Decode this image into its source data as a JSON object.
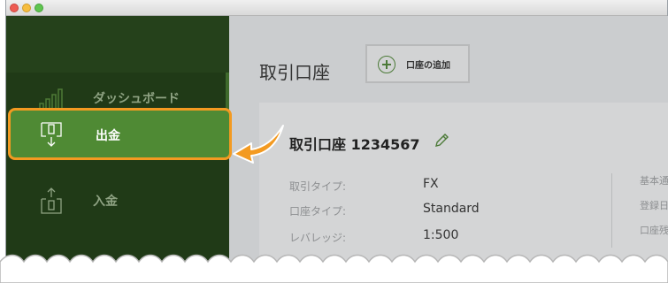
{
  "sidebar": {
    "items": [
      {
        "label": "ダッシュボード",
        "icon": "bar-chart-icon"
      },
      {
        "label": "出金",
        "icon": "withdraw-icon"
      },
      {
        "label": "入金",
        "icon": "deposit-icon"
      }
    ]
  },
  "main": {
    "title": "取引口座",
    "add_button_label": "口座の追加"
  },
  "account": {
    "title": "取引口座 1234567",
    "rows": [
      {
        "label": "取引タイプ:",
        "value": "FX"
      },
      {
        "label": "口座タイプ:",
        "value": "Standard"
      },
      {
        "label": "レバレッジ:",
        "value": "1:500"
      }
    ],
    "side_labels": [
      "基本通",
      "登録日",
      "口座残"
    ]
  },
  "colors": {
    "sidebar_bg": "#203a17",
    "highlight_bg": "#4f8a34",
    "highlight_border": "#f39a21",
    "accent_green": "#4c7a38"
  }
}
